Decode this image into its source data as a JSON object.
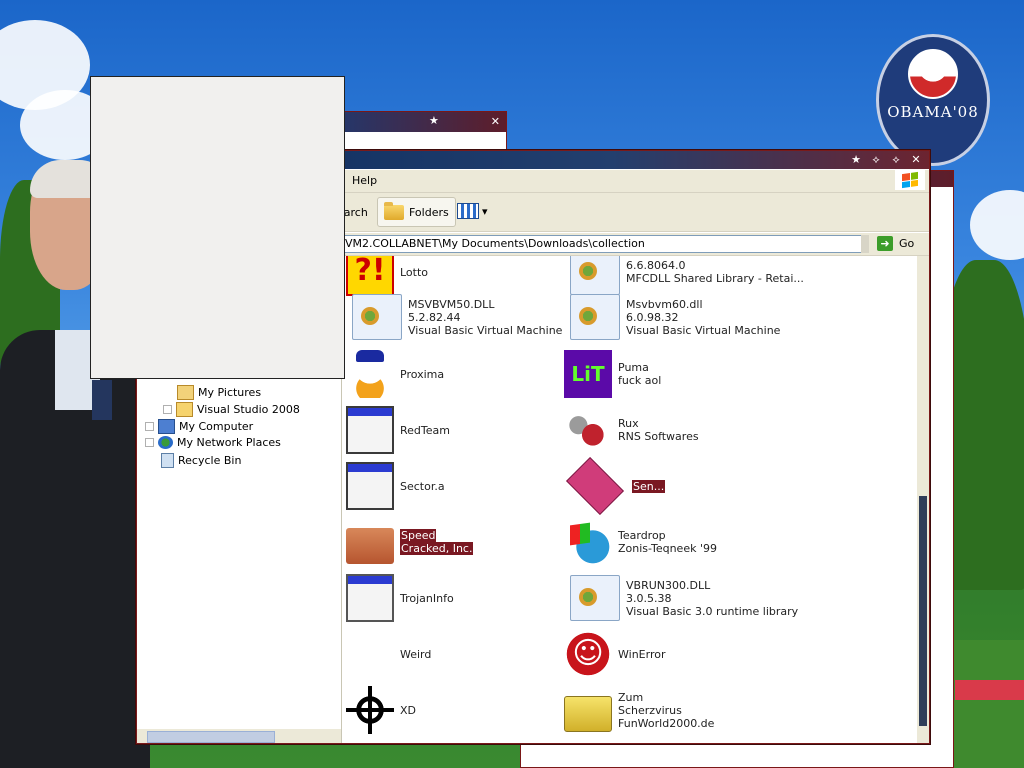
{
  "badge": {
    "text": "OBAMA'08"
  },
  "back_window": {
    "title_icon": "star-icon",
    "close": "✕"
  },
  "window": {
    "buttons": {
      "star": "★",
      "restore": "⟡",
      "maximize": "⟡",
      "close": "✕"
    },
    "menu": {
      "help": "Help"
    },
    "toolbar": {
      "search_label": "earch",
      "folders_label": "Folders"
    },
    "address": {
      "value": "VM2.COLLABNET\\My Documents\\Downloads\\collection",
      "go_label": "Go"
    },
    "tree": [
      {
        "label": "My Pictures"
      },
      {
        "label": "Visual Studio 2008"
      },
      {
        "label": "My Computer"
      },
      {
        "label": "My Network Places"
      },
      {
        "label": "Recycle Bin"
      }
    ],
    "files": [
      {
        "icon": "lotto-icon",
        "lines": [
          "Lotto"
        ]
      },
      {
        "icon": "dll-icon",
        "lines": [
          "6.6.8064.0",
          "MFCDLL Shared Library - Retai..."
        ]
      },
      {
        "icon": "dll-icon",
        "lines": [
          "MSVBVM50.DLL",
          "5.2.82.44",
          "Visual Basic Virtual Machine"
        ]
      },
      {
        "icon": "dll-icon",
        "lines": [
          "Msvbvm60.dll",
          "6.0.98.32",
          "Visual Basic Virtual Machine"
        ]
      },
      {
        "icon": "duck-icon",
        "lines": [
          "Proxima"
        ]
      },
      {
        "icon": "puma-icon",
        "lines": [
          "Puma",
          "fuck aol"
        ]
      },
      {
        "icon": "exe-icon",
        "lines": [
          "RedTeam"
        ]
      },
      {
        "icon": "rux-icon",
        "lines": [
          "Rux",
          "RNS Softwares"
        ]
      },
      {
        "icon": "exe-icon",
        "lines": [
          "Sector.a"
        ]
      },
      {
        "icon": "diamond-icon",
        "lines": [
          "Sen..."
        ]
      },
      {
        "icon": "folder-icon",
        "lines": [
          "Speed",
          "Cracked, Inc."
        ]
      },
      {
        "icon": "teardrop-icon",
        "lines": [
          "Teardrop",
          "Zonis-Teqneek '99"
        ]
      },
      {
        "icon": "window-icon",
        "lines": [
          "TrojanInfo"
        ]
      },
      {
        "icon": "dll-icon",
        "lines": [
          "VBRUN300.DLL",
          "3.0.5.38",
          "Visual Basic 3.0 runtime library"
        ]
      },
      {
        "icon": "none",
        "lines": [
          "Weird"
        ]
      },
      {
        "icon": "winerror-icon",
        "lines": [
          "WinError"
        ]
      },
      {
        "icon": "crosshair-icon",
        "lines": [
          "XD"
        ]
      },
      {
        "icon": "yellow-folder-icon",
        "lines": [
          "Zum",
          "Scherzvirus",
          "FunWorld2000.de"
        ]
      }
    ]
  }
}
